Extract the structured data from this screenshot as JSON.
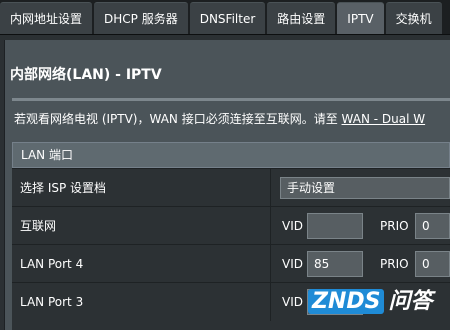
{
  "tabs": [
    {
      "label": "内网地址设置"
    },
    {
      "label": "DHCP 服务器"
    },
    {
      "label": "DNSFilter"
    },
    {
      "label": "路由设置"
    },
    {
      "label": "IPTV"
    },
    {
      "label": "交换机"
    }
  ],
  "active_tab": "IPTV",
  "page": {
    "title": "内部网络(LAN) - IPTV",
    "description_prefix": "若观看网络电视 (IPTV)，WAN 接口必须连接至互联网。请至 ",
    "description_link": "WAN - Dual W"
  },
  "lan_port_table": {
    "header": "LAN 端口",
    "isp_row": {
      "label": "选择 ISP 设置档",
      "value": "手动设置"
    },
    "rows": [
      {
        "label": "互联网",
        "vid_label": "VID",
        "vid": "",
        "prio_label": "PRIO",
        "prio": "0"
      },
      {
        "label": "LAN Port 4",
        "vid_label": "VID",
        "vid": "85",
        "prio_label": "PRIO",
        "prio": "0"
      },
      {
        "label": "LAN Port 3",
        "vid_label": "VID",
        "vid": "",
        "prio_label": "",
        "prio": ""
      }
    ]
  },
  "watermark": {
    "brand": "ZNDS",
    "text": "问答"
  },
  "colors": {
    "panel": "#4b5459",
    "table_bg": "#2c3134",
    "header_bg": "#5f6a70",
    "tab_active": "#596066"
  }
}
